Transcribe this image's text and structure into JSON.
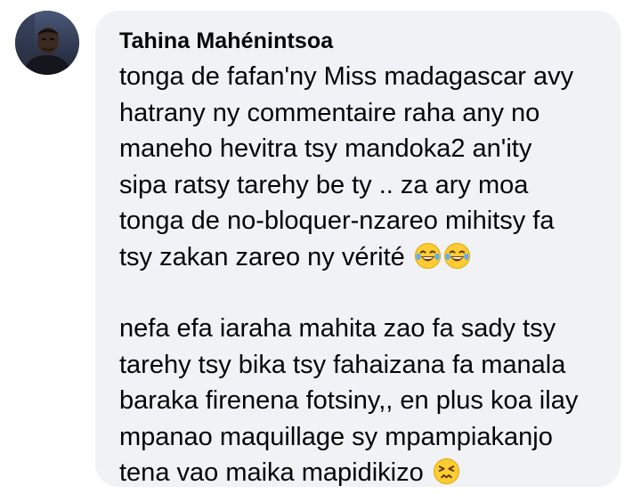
{
  "comment": {
    "author": "Tahina Mahénintsoa",
    "paragraph1": [
      "tonga de fafan'ny Miss madagascar avy",
      "hatrany ny commentaire raha any no",
      "maneho hevitra tsy mandoka2 an'ity",
      "sipa ratsy tarehy be ty .. za ary moa",
      "tonga de no-bloquer-nzareo mihitsy fa",
      "tsy zakan zareo ny vérité"
    ],
    "paragraph2": [
      "nefa efa iaraha mahita zao fa sady tsy",
      "tarehy tsy bika tsy fahaizana fa manala",
      "baraka firenena fotsiny,, en plus koa ilay",
      "mpanao maquillage sy mpampiakanjo",
      "tena vao maika mapidikizo"
    ],
    "emojis": {
      "line6": [
        "face-with-tears-of-joy-icon",
        "face-with-tears-of-joy-icon"
      ],
      "line11": [
        "persevering-face-icon"
      ]
    }
  },
  "colors": {
    "bubble_bg": "#f0f2f5",
    "text": "#050505",
    "emoji_yellow": "#ffcc33",
    "emoji_tears": "#5aaef5"
  }
}
